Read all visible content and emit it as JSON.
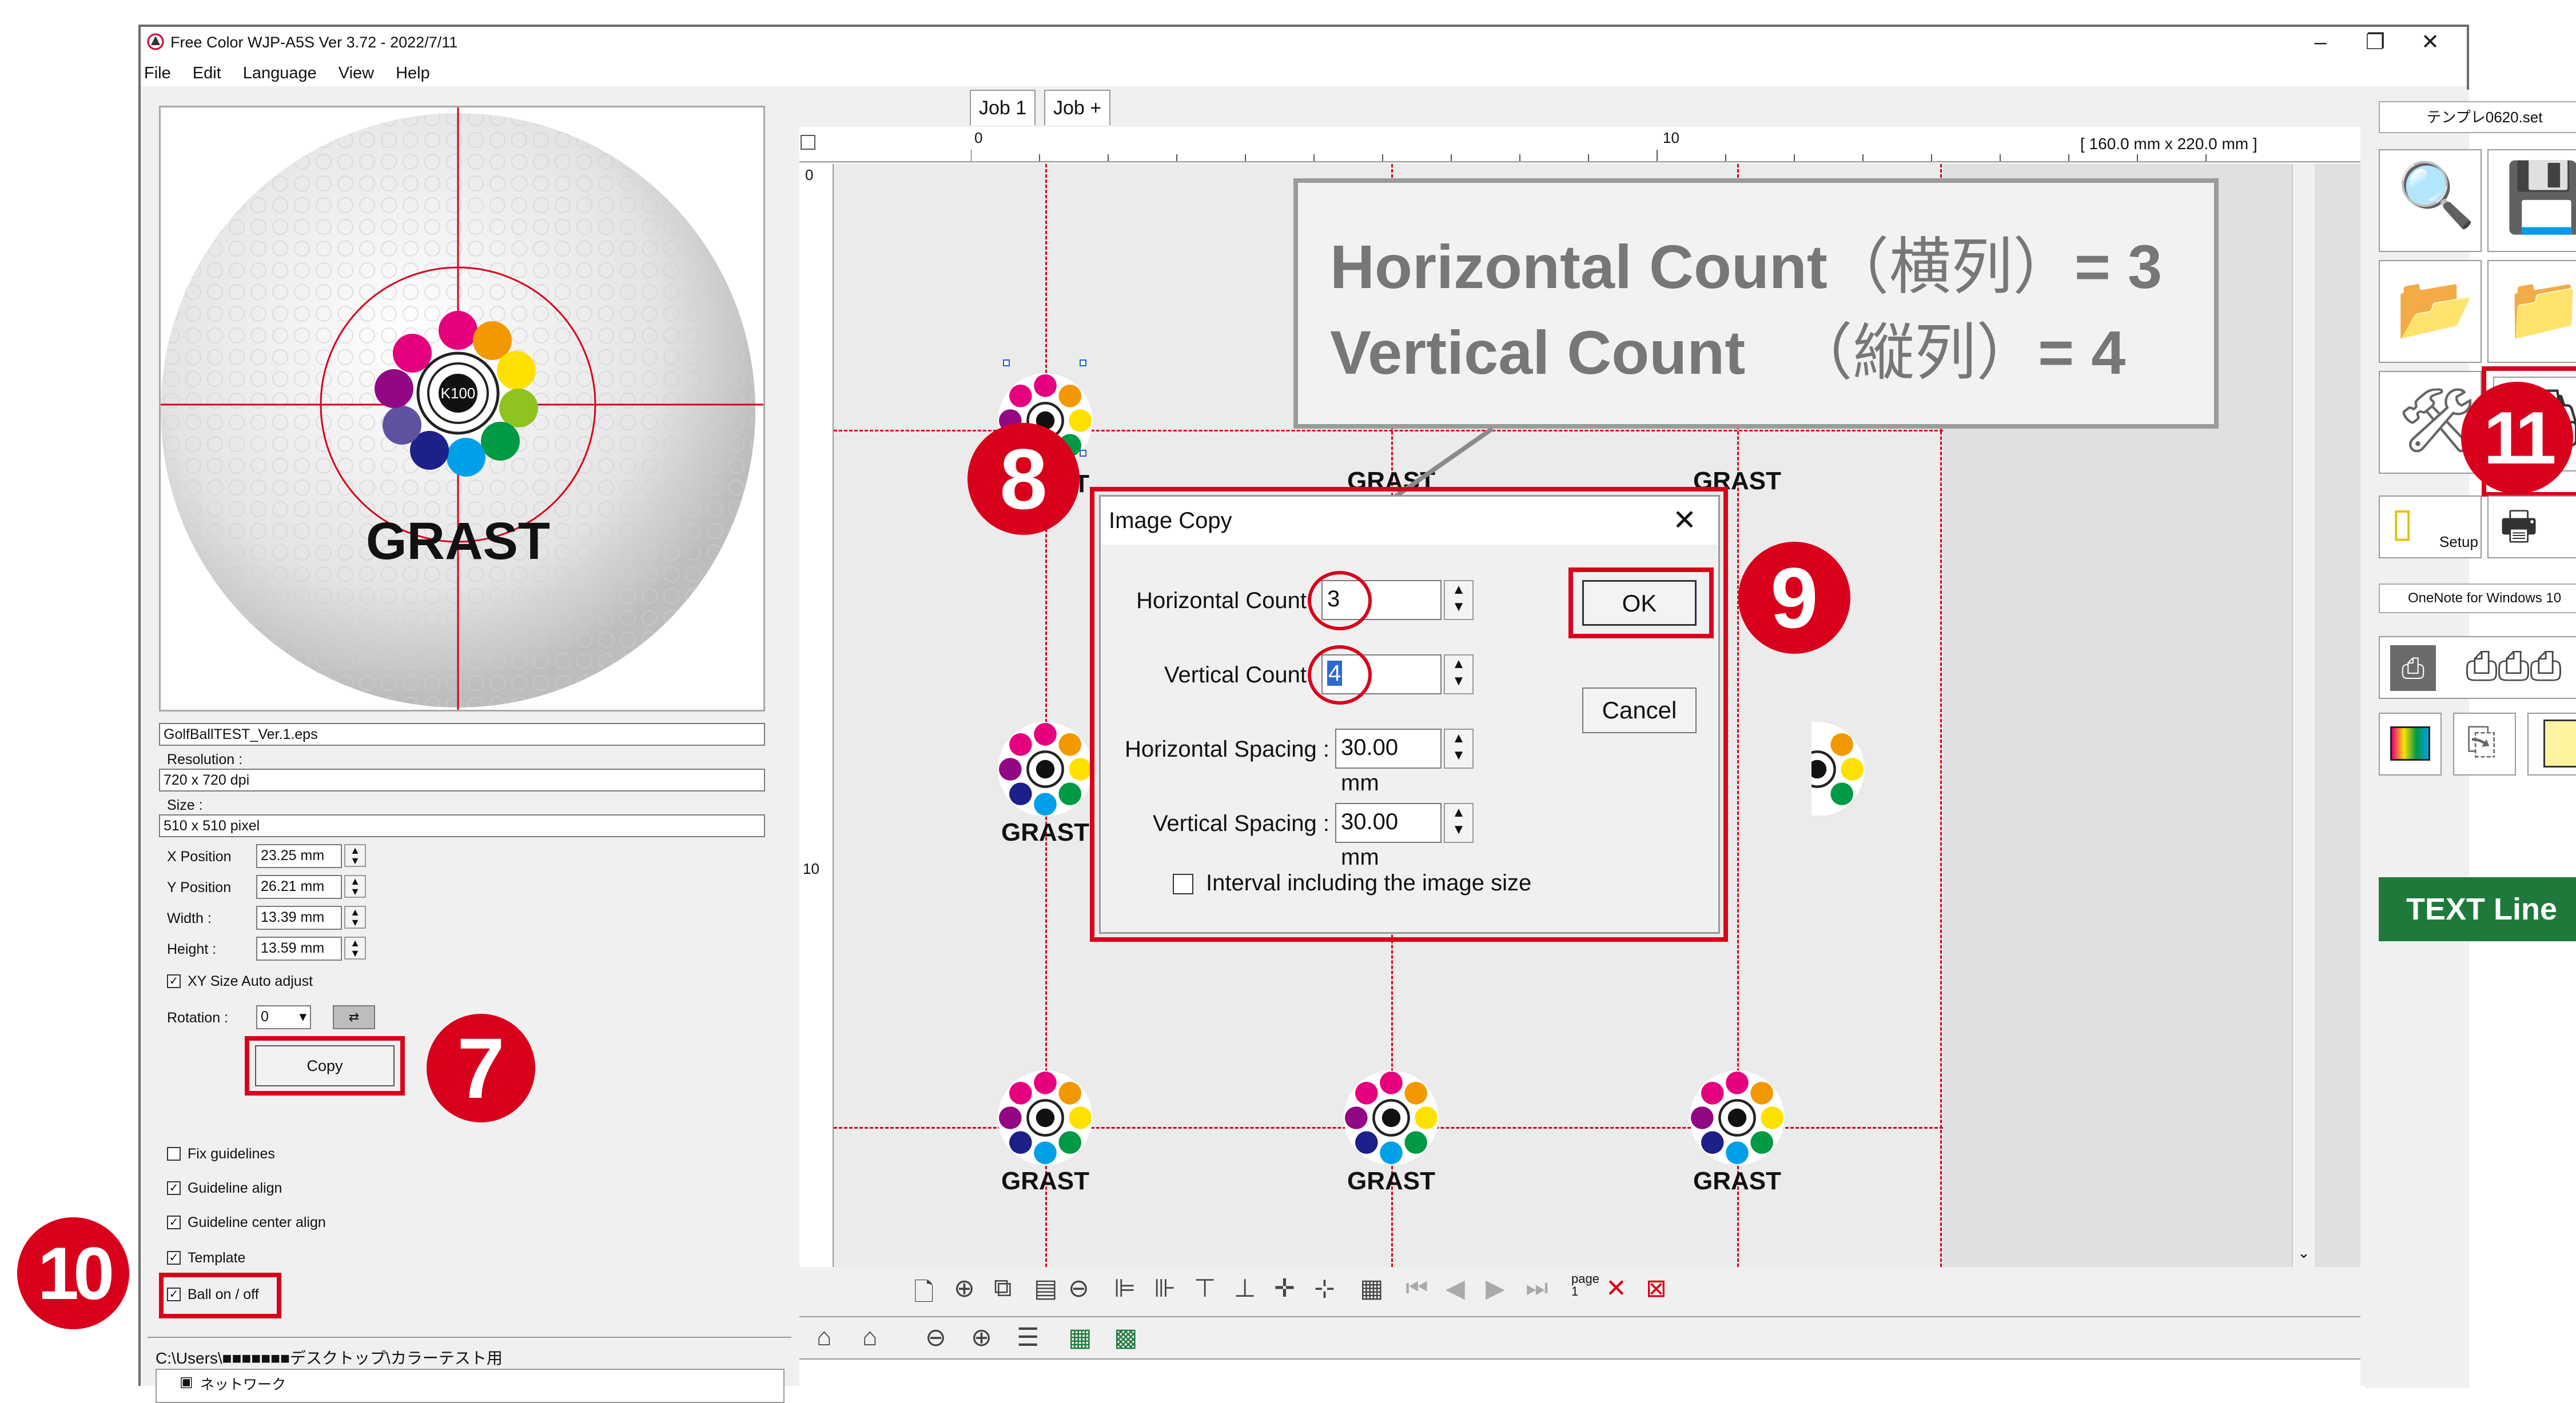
{
  "window": {
    "title": "Free Color WJP-A5S Ver 3.72 - 2022/7/11",
    "minimize": "–",
    "restore": "❐",
    "close": "✕"
  },
  "menu": [
    "File",
    "Edit",
    "Language",
    "View",
    "Help"
  ],
  "left_panel": {
    "file_name": "GolfBallTEST_Ver.1.eps",
    "resolution_label": "Resolution :",
    "resolution_value": "720 x 720 dpi",
    "size_label": "Size :",
    "size_value": "510 x 510 pixel",
    "x_position_label": "X Position",
    "x_position_value": "23.25 mm",
    "y_position_label": "Y Position",
    "y_position_value": "26.21 mm",
    "width_label": "Width :",
    "width_value": "13.39 mm",
    "height_label": "Height :",
    "height_value": "13.59 mm",
    "xy_auto_label": "XY Size Auto adjust",
    "rotation_label": "Rotation :",
    "rotation_value": "0",
    "copy_button": "Copy",
    "fix_guidelines": "Fix guidelines",
    "guideline_align": "Guideline align",
    "guideline_center_align": "Guideline center align",
    "template": "Template",
    "ball_on_off": "Ball on / off",
    "path": "C:\\Users\\■■■■■■■デスクトップ\\カラーテスト用",
    "tree_item": "ネットワーク",
    "preview_logo": "GRAST",
    "preview_center": "K100"
  },
  "tabs": [
    "Job 1",
    "Job +"
  ],
  "ruler": {
    "zero": "0",
    "ten": "10",
    "size_info": "[ 160.0 mm x 220.0 mm ]"
  },
  "vruler": {
    "zero": "0",
    "ten": "10"
  },
  "canvas_logo": "GRAST",
  "callout": {
    "line1_label": "Horizontal Count",
    "line1_jp": "（横列）",
    "line1_value": "= 3",
    "line2_label": "Vertical Count",
    "line2_jp": "（縦列）",
    "line2_value": "= 4"
  },
  "dialog": {
    "title": "Image Copy",
    "close": "✕",
    "horizontal_count_label": "Horizontal Count",
    "horizontal_count_value": "3",
    "vertical_count_label": "Vertical Count",
    "vertical_count_value": "4",
    "horizontal_spacing_label": "Horizontal Spacing :",
    "horizontal_spacing_value": "30.00 mm",
    "vertical_spacing_label": "Vertical Spacing :",
    "vertical_spacing_value": "30.00 mm",
    "interval_label": "Interval including the image size",
    "ok": "OK",
    "cancel": "Cancel"
  },
  "right_panel": {
    "template_name": "テンプレ0620.set",
    "setup_label": "Setup",
    "printer_name": "OneNote for Windows 10",
    "text_line": "TEXT Line"
  },
  "bottom_toolbar": {
    "page_label": "page\n1"
  },
  "badges": {
    "b7": "7",
    "b8": "8",
    "b9": "9",
    "b10": "10",
    "b11": "11"
  },
  "colors": {
    "annotation_red": "#d9001b",
    "text_line_green": "#1e7a3b",
    "callout_gray": "#777777"
  }
}
